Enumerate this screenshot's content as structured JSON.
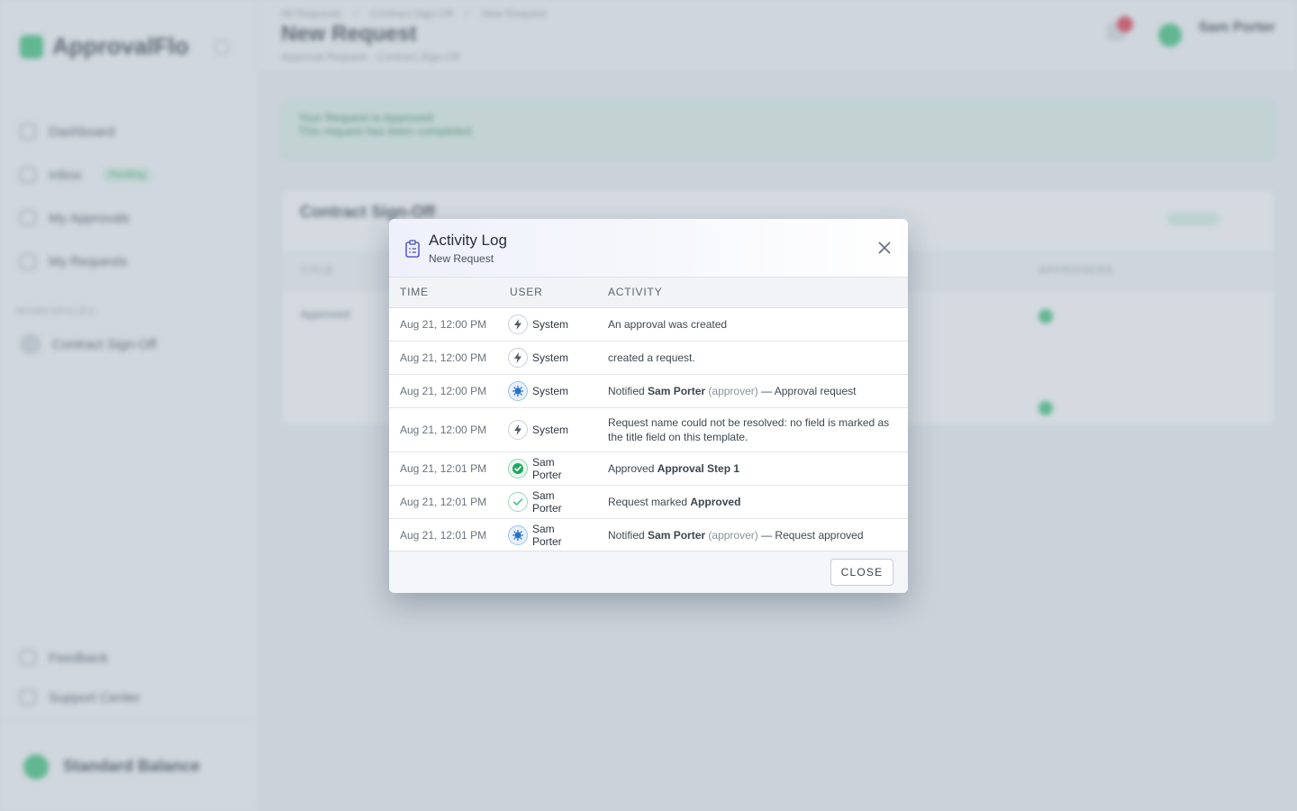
{
  "background": {
    "brand": "ApprovalFlo",
    "nav_items": [
      {
        "label": "Dashboard"
      },
      {
        "label": "Inbox",
        "badge": "Pending"
      },
      {
        "label": "My Approvals"
      },
      {
        "label": "My Requests"
      }
    ],
    "section_label": "WORKSPACES",
    "workspace": "Contract Sign-Off",
    "bottom_items": [
      {
        "label": "Feedback"
      },
      {
        "label": "Support Center"
      }
    ],
    "org_name": "Standard Balance",
    "breadcrumbs": [
      "All Requests",
      "/",
      "Contract Sign-Off",
      "/",
      "New Request"
    ],
    "page_title": "New Request",
    "page_subtitle": "Approval Request · Contract Sign-Off",
    "top_user": "Sam Porter",
    "alert_title": "Your Request is Approved",
    "alert_text": "This request has been completed.",
    "card_title": "Contract Sign-Off",
    "card_columns": [
      "TITLE",
      "APPROVERS"
    ],
    "card_row": "Approved"
  },
  "modal": {
    "title": "Activity Log",
    "subtitle": "New Request",
    "columns": {
      "time": "TIME",
      "user": "USER",
      "activity": "ACTIVITY"
    },
    "rows": [
      {
        "time": "Aug 21, 12:00 PM",
        "icon": "bolt-icon",
        "user": "System",
        "parts": [
          {
            "t": "An approval was created"
          }
        ]
      },
      {
        "time": "Aug 21, 12:00 PM",
        "icon": "bolt-icon",
        "user": "System",
        "parts": [
          {
            "t": "created a request."
          }
        ]
      },
      {
        "time": "Aug 21, 12:00 PM",
        "icon": "notify-icon",
        "user": "System",
        "parts": [
          {
            "t": "Notified "
          },
          {
            "t": "Sam Porter",
            "b": true
          },
          {
            "t": " (approver)",
            "m": true
          },
          {
            "t": " — Approval request"
          }
        ]
      },
      {
        "time": "Aug 21, 12:00 PM",
        "icon": "bolt-icon",
        "user": "System",
        "tall": true,
        "parts": [
          {
            "t": "Request name could not be resolved: no field is marked as the title field on this template."
          }
        ]
      },
      {
        "time": "Aug 21, 12:01 PM",
        "icon": "approved-icon",
        "user": "Sam Porter",
        "parts": [
          {
            "t": "Approved "
          },
          {
            "t": "Approval Step 1",
            "b": true
          }
        ]
      },
      {
        "time": "Aug 21, 12:01 PM",
        "icon": "check-icon",
        "user": "Sam Porter",
        "parts": [
          {
            "t": "Request marked "
          },
          {
            "t": "Approved",
            "b": true
          }
        ]
      },
      {
        "time": "Aug 21, 12:01 PM",
        "icon": "notify-icon",
        "user": "Sam Porter",
        "parts": [
          {
            "t": "Notified "
          },
          {
            "t": "Sam Porter",
            "b": true
          },
          {
            "t": " (approver)",
            "m": true
          },
          {
            "t": " — Request approved"
          }
        ]
      }
    ],
    "close_label": "CLOSE"
  },
  "colors": {
    "accent": "#5a5fc8",
    "success": "#2fbf71",
    "info": "#2a6fd1",
    "overlay": "#a0acba"
  }
}
